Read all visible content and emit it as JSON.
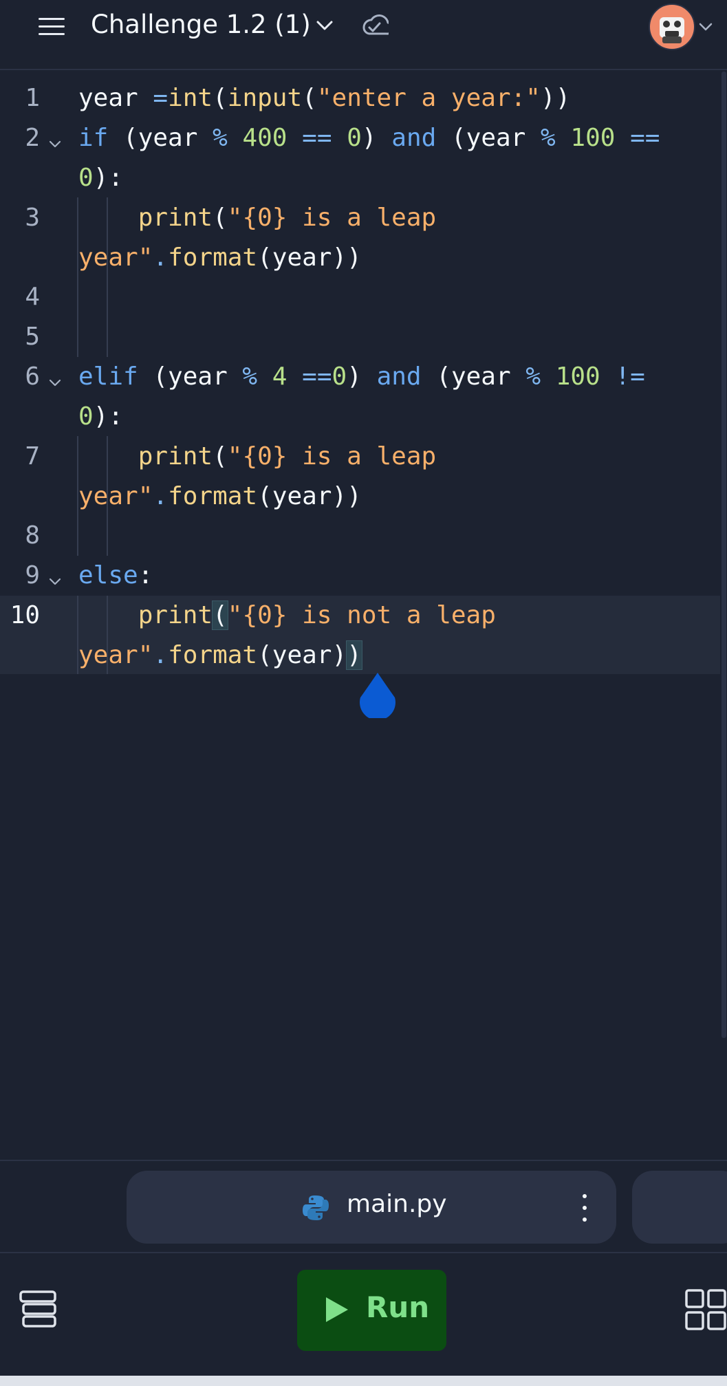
{
  "header": {
    "title": "Challenge 1.2 (1)",
    "menu_icon": "hamburger-menu-icon",
    "title_dropdown_icon": "chevron-down-icon",
    "status_icon": "cloud-check-icon",
    "avatar_icon": "user-avatar",
    "avatar_dropdown_icon": "chevron-down-icon"
  },
  "editor": {
    "active_line": 10,
    "lines": [
      {
        "n": "1",
        "fold": false
      },
      {
        "n": "2",
        "fold": true
      },
      {
        "n": "3",
        "fold": false
      },
      {
        "n": "4",
        "fold": false
      },
      {
        "n": "5",
        "fold": false
      },
      {
        "n": "6",
        "fold": true
      },
      {
        "n": "7",
        "fold": false
      },
      {
        "n": "8",
        "fold": false
      },
      {
        "n": "9",
        "fold": true
      },
      {
        "n": "10",
        "fold": false
      }
    ],
    "code": {
      "l1": {
        "t1": "year ",
        "t2": "=",
        "t3": "int",
        "t4": "(",
        "t5": "input",
        "t6": "(",
        "t7": "\"enter a year:\"",
        "t8": "))"
      },
      "l2a": {
        "t1": "if",
        "t2": " (year ",
        "t3": "%",
        "t4": " ",
        "t5": "400",
        "t6": " ",
        "t7": "==",
        "t8": " ",
        "t9": "0",
        "t10": ") ",
        "t11": "and",
        "t12": " (year ",
        "t13": "%",
        "t14": " ",
        "t15": "100",
        "t16": " ",
        "t17": "=="
      },
      "l2b": {
        "t1": "0",
        "t2": "):"
      },
      "l3a": {
        "t1": "    ",
        "t2": "print",
        "t3": "(",
        "t4": "\"{0} is a leap"
      },
      "l3b": {
        "t1": "year\"",
        "t2": ".",
        "t3": "format",
        "t4": "(year))"
      },
      "l6a": {
        "t1": "elif",
        "t2": " (year ",
        "t3": "%",
        "t4": " ",
        "t5": "4",
        "t6": " ",
        "t7": "==",
        "t8": "0",
        "t9": ") ",
        "t10": "and",
        "t11": " (year ",
        "t12": "%",
        "t13": " ",
        "t14": "100",
        "t15": " ",
        "t16": "!="
      },
      "l6b": {
        "t1": "0",
        "t2": "):"
      },
      "l7a": {
        "t1": "    ",
        "t2": "print",
        "t3": "(",
        "t4": "\"{0} is a leap"
      },
      "l7b": {
        "t1": "year\"",
        "t2": ".",
        "t3": "format",
        "t4": "(year))"
      },
      "l9": {
        "t1": "else",
        "t2": ":"
      },
      "l10a": {
        "t1": "    ",
        "t2": "print",
        "t3": "(",
        "t4": "\"{0} is not a leap"
      },
      "l10b": {
        "t1": "year\"",
        "t2": ".",
        "t3": "format",
        "t4": "(year)",
        "t5": ")"
      }
    }
  },
  "file_tabs": {
    "active": {
      "name": "main.py",
      "icon": "python-icon",
      "menu_icon": "kebab-menu-icon"
    }
  },
  "bottom_bar": {
    "left_icon": "layers-icon",
    "run_label": "Run",
    "run_icon": "play-icon",
    "right_icon": "grid-icon"
  },
  "colors": {
    "background": "#1c2230",
    "string": "#f8b06a",
    "function": "#f4d48a",
    "number": "#b8e08a",
    "keyword": "#6aa9f0",
    "operator": "#7fb6f0",
    "run_button": "#0b4d12",
    "run_text": "#7fe08a",
    "cursor": "#0b5bd3"
  }
}
